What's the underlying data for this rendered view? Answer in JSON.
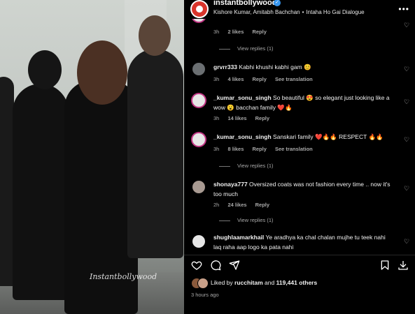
{
  "post": {
    "username": "instantbollywood",
    "subtitle_artists": "Kishore Kumar, Amitabh Bachchan",
    "subtitle_dot": "•",
    "subtitle_song": "Intaha Ho Gai Dialogue",
    "watermark": "Instantbollywood",
    "likes_prefix": "Liked by",
    "likes_user": "rucchitam",
    "likes_and": "and",
    "likes_count": "119,441 others",
    "time_ago": "3 hours ago"
  },
  "comments": [
    {
      "time": "3h",
      "likes": "2 likes",
      "reply": "Reply",
      "translation": ""
    },
    {
      "view_replies": "View replies (1)"
    },
    {
      "user": "grvrr333",
      "text": "Kabhi khushi kabhi gam 😊",
      "time": "3h",
      "likes": "4 likes",
      "reply": "Reply",
      "translation": ""
    },
    {
      "user": "_kumar_sonu_singh",
      "text": "So beautiful 😍 so elegant just looking like a wow 😮 bacchan family ❤️🔥",
      "time": "3h",
      "likes": "14 likes",
      "reply": "Reply",
      "translation": ""
    },
    {
      "user": "_kumar_sonu_singh",
      "text": "Sanskari family ❤️🔥🔥 RESPECT 🔥🔥",
      "time": "3h",
      "likes": "8 likes",
      "reply": "Reply",
      "translation": "See translation"
    },
    {
      "view_replies": "View replies (1)"
    },
    {
      "user": "shonaya777",
      "text": "Oversized coats was not fashion every time .. now it's too much",
      "time": "2h",
      "likes": "24 likes",
      "reply": "Reply",
      "translation": ""
    },
    {
      "view_replies": "View replies (1)"
    },
    {
      "user": "shughlaamarkhail",
      "text": "Ye aradhya ka chal chalan mujhe tu teek nahi laq raha aap logo ka pata nahi",
      "time": "",
      "likes": "",
      "reply": "",
      "translation": ""
    }
  ],
  "translation_label": "See translation",
  "icons": {
    "more": "more-icon",
    "heart": "heart-icon",
    "comment": "comment-icon",
    "share": "share-icon",
    "save": "bookmark-icon",
    "download": "download-icon"
  },
  "colors": {
    "verified": "#3897f0",
    "avatar_ring": "#c13584",
    "brand": "#d9342b"
  }
}
